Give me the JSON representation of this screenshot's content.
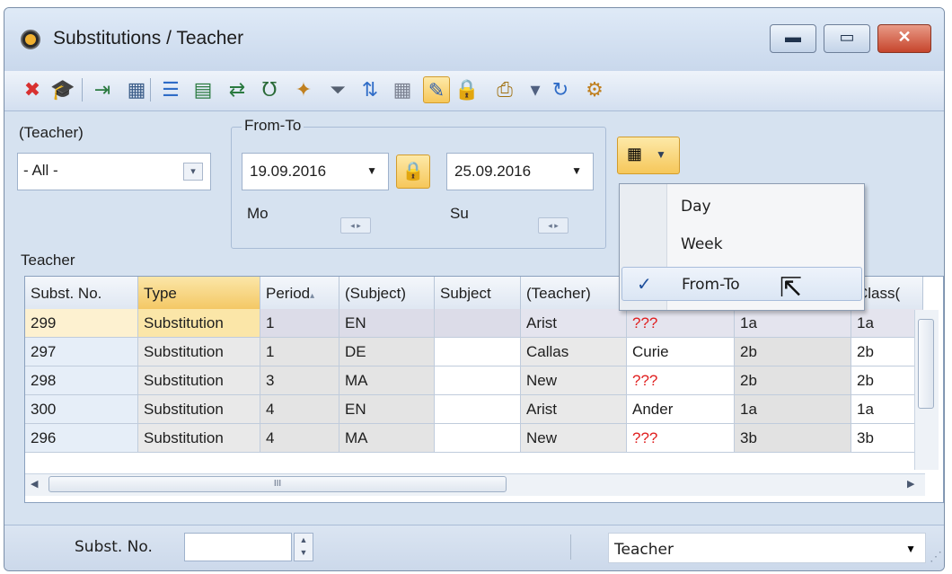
{
  "window": {
    "title": "Substitutions / Teacher",
    "min_glyph": "▬",
    "max_glyph": "▭",
    "close_glyph": "✕"
  },
  "toolbar": {
    "buttons": [
      {
        "name": "delete-icon",
        "glyph": "✖",
        "color": "#d83030"
      },
      {
        "name": "teacher-hat-icon",
        "glyph": "🎓",
        "color": "#303030"
      },
      {
        "name": "exit-icon",
        "glyph": "⇥",
        "color": "#2a7a40"
      },
      {
        "name": "calculator-icon",
        "glyph": "▦",
        "color": "#3a5c88"
      },
      {
        "name": "list-icon",
        "glyph": "☰",
        "color": "#2f6cc7"
      },
      {
        "name": "calendar-icon",
        "glyph": "▤",
        "color": "#2a7a40"
      },
      {
        "name": "swap-icon",
        "glyph": "⇄",
        "color": "#2a7a40"
      },
      {
        "name": "stethoscope-icon",
        "glyph": "℧",
        "color": "#2a6a38"
      },
      {
        "name": "wand-icon",
        "glyph": "✦",
        "color": "#c08020"
      },
      {
        "name": "filter-icon",
        "glyph": "⏷",
        "color": "#556070"
      },
      {
        "name": "sort-az-icon",
        "glyph": "⇅",
        "color": "#2f6cc7"
      },
      {
        "name": "grid-icon",
        "glyph": "▦",
        "color": "#7a8090"
      },
      {
        "name": "palette-icon",
        "glyph": "✎",
        "color": "#3060b0"
      },
      {
        "name": "lock-icon",
        "glyph": "🔒",
        "color": "#a07010"
      },
      {
        "name": "print-icon",
        "glyph": "⎙",
        "color": "#a07010"
      },
      {
        "name": "dropdown-icon",
        "glyph": "▾",
        "color": "#506080"
      },
      {
        "name": "refresh-icon",
        "glyph": "↻",
        "color": "#2f6cc7"
      },
      {
        "name": "settings-gear-icon",
        "glyph": "⚙",
        "color": "#c08020"
      }
    ]
  },
  "filter": {
    "teacher_label": "(Teacher)",
    "teacher_value": "- All -",
    "teacher_heading": "Teacher",
    "fromto_label": "From-To",
    "from_date": "19.09.2016",
    "to_date": "25.09.2016",
    "from_day": "Mo",
    "to_day": "Su",
    "spin_glyph": "◂ ▸",
    "dd_glyph": "▾",
    "date_arrow": "▼",
    "lock_glyph": "🔒",
    "cal_glyph": "▦",
    "cal_tri": "▼"
  },
  "grid": {
    "columns": [
      "Subst. No.",
      "Type",
      "Period",
      "(Subject)",
      "Subject",
      "(Teacher)",
      "",
      "",
      "Class("
    ],
    "sort_glyph": "▴",
    "rows": [
      [
        "299",
        "Substitution",
        "1",
        "EN",
        "",
        "Arist",
        "???",
        "1a",
        "1a"
      ],
      [
        "297",
        "Substitution",
        "1",
        "DE",
        "",
        "Callas",
        "Curie",
        "2b",
        "2b"
      ],
      [
        "298",
        "Substitution",
        "3",
        "MA",
        "",
        "New",
        "???",
        "2b",
        "2b"
      ],
      [
        "300",
        "Substitution",
        "4",
        "EN",
        "",
        "Arist",
        "Ander",
        "1a",
        "1a"
      ],
      [
        "296",
        "Substitution",
        "4",
        "MA",
        "",
        "New",
        "???",
        "3b",
        "3b"
      ]
    ],
    "scroll_up": "▲",
    "scroll_down": "▼",
    "scroll_left": "◀",
    "scroll_right": "▶",
    "hthumb_grip": "III",
    "vthumb_grip": "≡"
  },
  "popup": {
    "items": [
      "Day",
      "Week",
      "From-To"
    ],
    "check_glyph": "✓"
  },
  "statusbar": {
    "subst_label": "Subst. No.",
    "subst_value": "",
    "spin_up": "▲",
    "spin_down": "▼",
    "view_value": "Teacher",
    "view_arrow": "▼",
    "grip": "⋰"
  },
  "colors": {
    "accent": "#f6c75a",
    "row_selected": "#fbe6a8",
    "row_selected_first": "#f7d98a",
    "row_focus": "#dcdce8",
    "missing_teacher": "#e02020"
  }
}
